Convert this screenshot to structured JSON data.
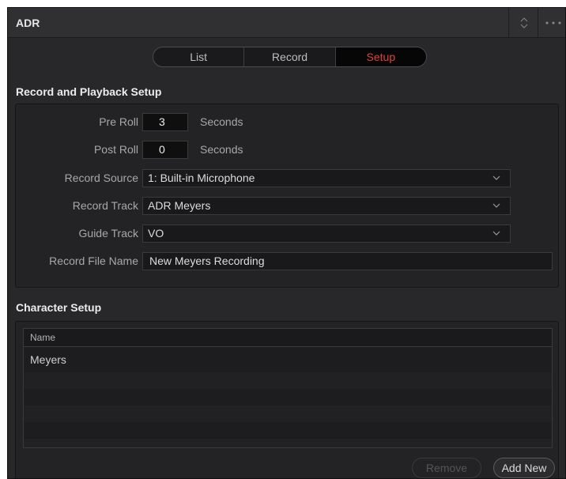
{
  "window": {
    "title": "ADR"
  },
  "tabs": [
    {
      "label": "List",
      "active": false
    },
    {
      "label": "Record",
      "active": false
    },
    {
      "label": "Setup",
      "active": true
    }
  ],
  "record_setup": {
    "heading": "Record and Playback Setup",
    "pre_roll": {
      "label": "Pre Roll",
      "value": "3",
      "unit": "Seconds"
    },
    "post_roll": {
      "label": "Post Roll",
      "value": "0",
      "unit": "Seconds"
    },
    "record_source": {
      "label": "Record Source",
      "value": "1: Built-in Microphone"
    },
    "record_track": {
      "label": "Record Track",
      "value": "ADR Meyers"
    },
    "guide_track": {
      "label": "Guide Track",
      "value": "VO"
    },
    "record_file_name": {
      "label": "Record File Name",
      "value": "New Meyers Recording"
    }
  },
  "character_setup": {
    "heading": "Character Setup",
    "column_header": "Name",
    "rows": [
      "Meyers"
    ],
    "remove_label": "Remove",
    "add_label": "Add New"
  },
  "colors": {
    "active_tab_text": "#e0403a",
    "panel_bg": "#28282b"
  },
  "icons": {
    "titlebar_toggle": "up-down-chevron-icon",
    "titlebar_options": "more-options-icon",
    "dropdown": "chevron-down-icon"
  }
}
